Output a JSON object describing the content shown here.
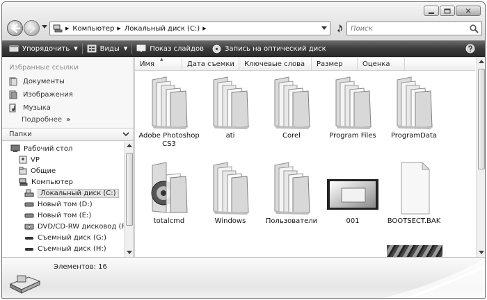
{
  "window": {
    "caption_buttons": [
      "minimize-icon",
      "maximize-icon",
      "close-icon"
    ]
  },
  "address": {
    "crumbs": [
      "Компьютер",
      "Локальный диск (C:)"
    ]
  },
  "search": {
    "placeholder": "Поиск"
  },
  "toolbar": {
    "organize": "Упорядочить",
    "views": "Виды",
    "slideshow": "Показ слайдов",
    "burn": "Запись на оптический диск"
  },
  "favorites": {
    "title": "Избранные ссылки",
    "items": [
      {
        "label": "Документы",
        "icon": "documents-icon"
      },
      {
        "label": "Изображения",
        "icon": "pictures-icon"
      },
      {
        "label": "Музыка",
        "icon": "music-icon"
      }
    ],
    "more": "Подробнее"
  },
  "folders": {
    "title": "Папки",
    "tree": [
      {
        "label": "Рабочий стол",
        "icon": "desktop-icon"
      },
      {
        "label": "VP",
        "icon": "user-folder-icon"
      },
      {
        "label": "Общие",
        "icon": "shared-folder-icon"
      },
      {
        "label": "Компьютер",
        "icon": "computer-icon"
      },
      {
        "label": "Локальный диск (C:)",
        "icon": "system-drive-icon",
        "selected": true
      },
      {
        "label": "Новый том (D:)",
        "icon": "drive-icon"
      },
      {
        "label": "Новый том (E:)",
        "icon": "drive-icon"
      },
      {
        "label": "DVD/CD-RW дисковод (F:)",
        "icon": "dvd-drive-icon"
      },
      {
        "label": "Съемный диск (G:)",
        "icon": "removable-drive-icon"
      },
      {
        "label": "Съемный диск (H:)",
        "icon": "removable-drive-icon"
      }
    ]
  },
  "columns": [
    "Имя",
    "Дата съемки",
    "Ключевые слова",
    "Размер",
    "Оценка"
  ],
  "files": [
    {
      "name": "Adobe Photoshop CS3",
      "type": "folder"
    },
    {
      "name": "ati",
      "type": "folder"
    },
    {
      "name": "Corel",
      "type": "folder"
    },
    {
      "name": "Program Files",
      "type": "folder"
    },
    {
      "name": "ProgramData",
      "type": "folder"
    },
    {
      "name": "totalcmd",
      "type": "folder"
    },
    {
      "name": "Windows",
      "type": "folder"
    },
    {
      "name": "Пользователи",
      "type": "folder"
    },
    {
      "name": "001",
      "type": "image"
    },
    {
      "name": "BOOTSECT.BAK",
      "type": "file"
    }
  ],
  "details": {
    "count_text": "Элементов: 16"
  }
}
